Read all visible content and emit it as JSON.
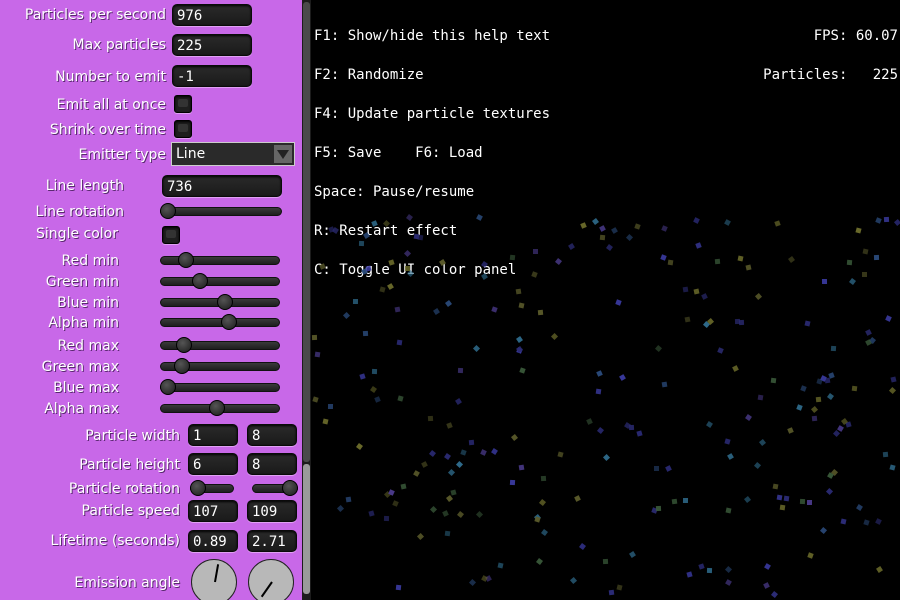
{
  "panel": {
    "particles_per_second": {
      "label": "Particles per second",
      "value": "976"
    },
    "max_particles": {
      "label": "Max particles",
      "value": "225"
    },
    "number_to_emit": {
      "label": "Number to emit",
      "value": "-1"
    },
    "emit_all_at_once": {
      "label": "Emit all at once",
      "checked": false
    },
    "shrink_over_time": {
      "label": "Shrink over time",
      "checked": false
    },
    "emitter_type": {
      "label": "Emitter type",
      "value": "Line"
    },
    "line_length": {
      "label": "Line length",
      "value": "736"
    },
    "line_rotation": {
      "label": "Line rotation",
      "fraction": 0.0
    },
    "single_color": {
      "label": "Single color",
      "checked": false
    },
    "red_min": {
      "label": "Red min",
      "fraction": 0.17
    },
    "green_min": {
      "label": "Green min",
      "fraction": 0.31
    },
    "blue_min": {
      "label": "Blue min",
      "fraction": 0.55
    },
    "alpha_min": {
      "label": "Alpha min",
      "fraction": 0.59
    },
    "red_max": {
      "label": "Red max",
      "fraction": 0.15
    },
    "green_max": {
      "label": "Green max",
      "fraction": 0.13
    },
    "blue_max": {
      "label": "Blue max",
      "fraction": 0.0
    },
    "alpha_max": {
      "label": "Alpha max",
      "fraction": 0.47
    },
    "particle_width": {
      "label": "Particle width",
      "min": "1",
      "max": "8"
    },
    "particle_height": {
      "label": "Particle height",
      "min": "6",
      "max": "8"
    },
    "particle_rotation": {
      "label": "Particle rotation",
      "min_fraction": 0.0,
      "max_fraction": 1.0
    },
    "particle_speed": {
      "label": "Particle speed",
      "min": "107",
      "max": "109"
    },
    "lifetime": {
      "label": "Lifetime (seconds)",
      "min": "0.89",
      "max": "2.71"
    },
    "emission_angle": {
      "label": "Emission angle"
    }
  },
  "help": {
    "lines": [
      "F1: Show/hide this help text",
      "F2: Randomize",
      "F4: Update particle textures",
      "F5: Save    F6: Load",
      "Space: Pause/resume",
      "R: Restart effect",
      "C: Toggle UI color panel"
    ]
  },
  "stats": {
    "fps": "FPS: 60.07",
    "particles": "Particles:   225"
  },
  "colors": {
    "panel_bg": "#c868e8",
    "viewport_bg": "#000000"
  }
}
